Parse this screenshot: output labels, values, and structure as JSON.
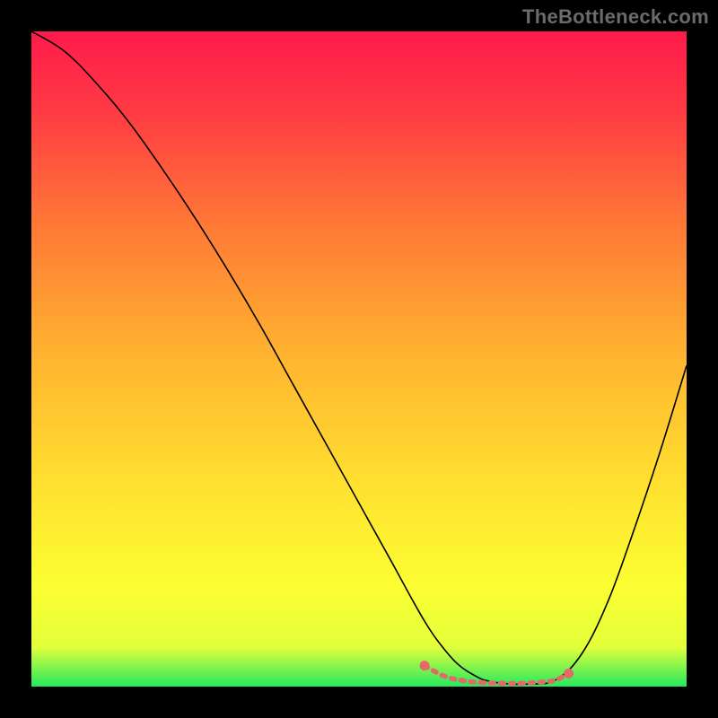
{
  "watermark": "TheBottleneck.com",
  "chart_data": {
    "type": "line",
    "title": "",
    "xlabel": "",
    "ylabel": "",
    "xlim": [
      0,
      100
    ],
    "ylim": [
      0,
      100
    ],
    "grid": false,
    "legend": false,
    "background_gradient": {
      "stops": [
        {
          "offset": 0.0,
          "color": "#ff1a4b"
        },
        {
          "offset": 0.12,
          "color": "#ff3a44"
        },
        {
          "offset": 0.3,
          "color": "#ff7a36"
        },
        {
          "offset": 0.5,
          "color": "#ffb530"
        },
        {
          "offset": 0.7,
          "color": "#ffe22f"
        },
        {
          "offset": 0.85,
          "color": "#fcff33"
        },
        {
          "offset": 0.94,
          "color": "#e2ff3a"
        },
        {
          "offset": 1.0,
          "color": "#25e95e"
        }
      ]
    },
    "series": [
      {
        "name": "curve",
        "color": "#000000",
        "width": 1.6,
        "x": [
          0,
          5,
          10,
          15,
          20,
          25,
          30,
          35,
          40,
          45,
          50,
          55,
          58,
          60,
          62,
          65,
          68,
          70,
          73,
          76,
          80,
          84,
          88,
          92,
          96,
          100
        ],
        "y": [
          100,
          97,
          92,
          86,
          79,
          71.5,
          63.5,
          55,
          46,
          37,
          28,
          19,
          13.5,
          10,
          7,
          3.5,
          1.5,
          0.8,
          0.4,
          0.4,
          1.0,
          5,
          13,
          24,
          36,
          49
        ]
      },
      {
        "name": "trough-highlight",
        "color": "#e46a6a",
        "width": 5.5,
        "dash": "4 7",
        "x": [
          60,
          63,
          66,
          69,
          72,
          75,
          78,
          80,
          82
        ],
        "y": [
          3.2,
          1.6,
          0.9,
          0.6,
          0.5,
          0.5,
          0.7,
          1.0,
          2.0
        ]
      }
    ],
    "trough_endpoints": [
      {
        "x": 60,
        "y": 3.2
      },
      {
        "x": 82,
        "y": 2.0
      }
    ]
  }
}
